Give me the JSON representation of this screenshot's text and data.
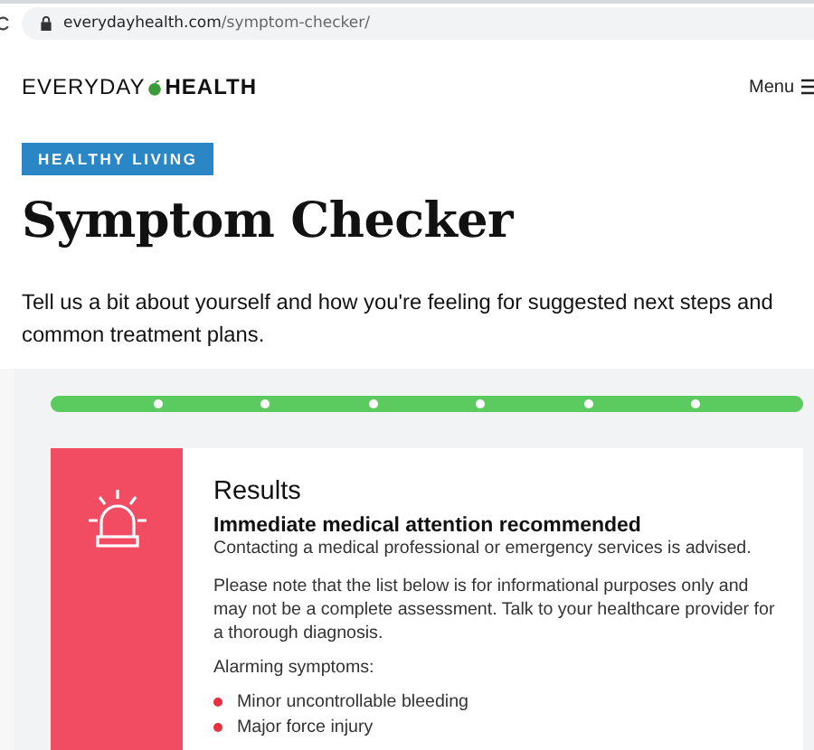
{
  "browser": {
    "url_domain": "everydayhealth.com",
    "url_path": "/symptom-checker/"
  },
  "header": {
    "logo_left": "EVERYDAY",
    "logo_right": "HEALTH",
    "menu": "Menu"
  },
  "badge": "HEALTHY LIVING",
  "title": "Symptom Checker",
  "intro": "Tell us a bit about yourself and how you're feeling for suggested next steps and common treatment plans.",
  "progress": {
    "level": 1
  },
  "result": {
    "heading": "Results",
    "verdict": "Immediate medical attention recommended",
    "advice": "Contacting a medical professional or emergency services is advised.",
    "note": "Please note that the list below is for informational purposes only and may not be a complete assessment. Talk to your healthcare provider for a thorough diagnosis.",
    "list_label": "Alarming symptoms:",
    "symptoms": [
      "Minor uncontrollable bleeding",
      "Major force injury"
    ]
  }
}
